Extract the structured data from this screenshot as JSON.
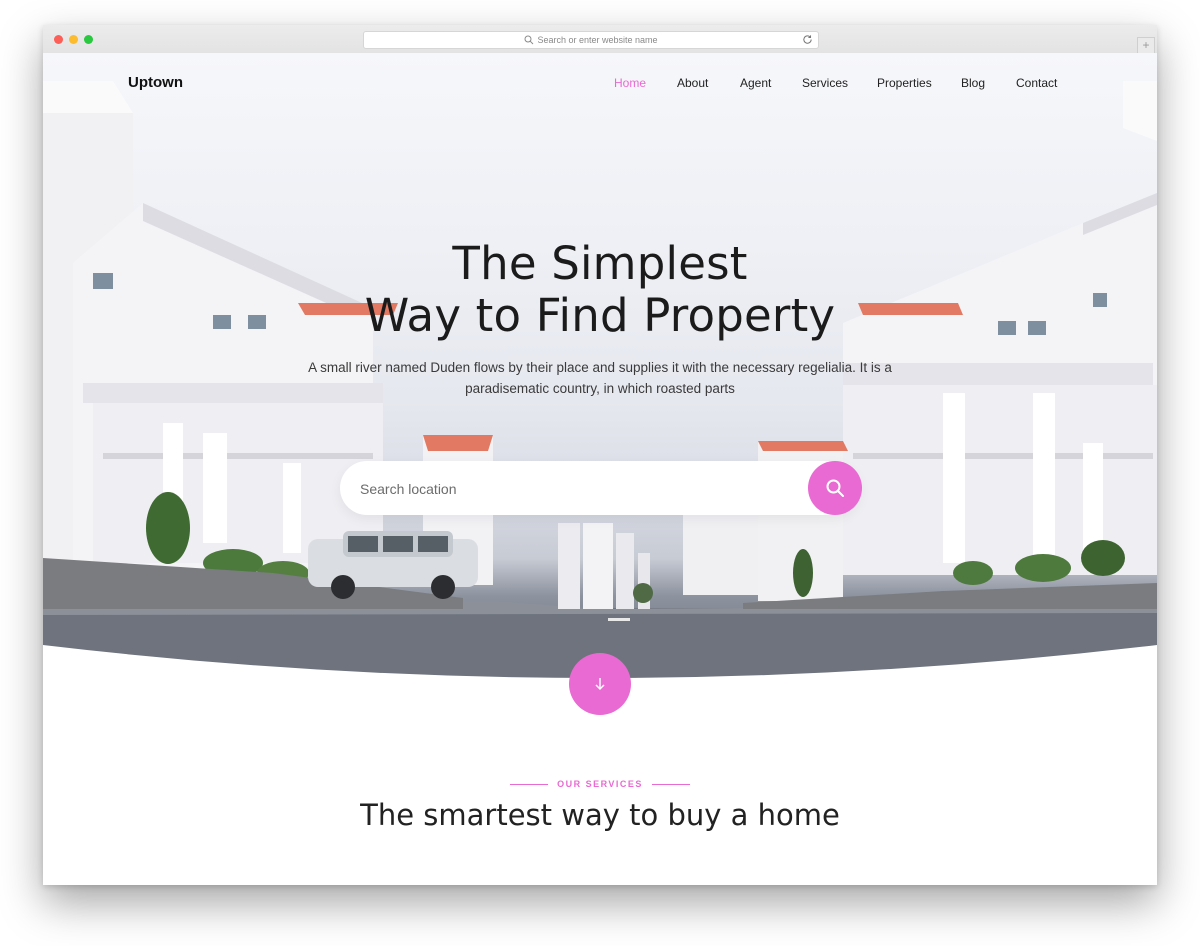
{
  "browser": {
    "url_placeholder": "Search or enter website name",
    "new_tab_label": "+"
  },
  "brand": {
    "name": "Uptown"
  },
  "nav": {
    "items": [
      {
        "label": "Home",
        "active": true
      },
      {
        "label": "About",
        "active": false
      },
      {
        "label": "Agent",
        "active": false
      },
      {
        "label": "Services",
        "active": false
      },
      {
        "label": "Properties",
        "active": false
      },
      {
        "label": "Blog",
        "active": false
      },
      {
        "label": "Contact",
        "active": false
      }
    ]
  },
  "hero": {
    "title_line1": "The Simplest",
    "title_line2": "Way to Find Property",
    "subtitle": "A small river named Duden flows by their place and supplies it with the necessary regelialia. It is a paradisematic country, in which roasted parts",
    "search_placeholder": "Search location"
  },
  "services": {
    "eyebrow": "OUR SERVICES",
    "title": "The smartest way to buy a home"
  },
  "colors": {
    "accent": "#e86ad2",
    "text": "#222222"
  }
}
